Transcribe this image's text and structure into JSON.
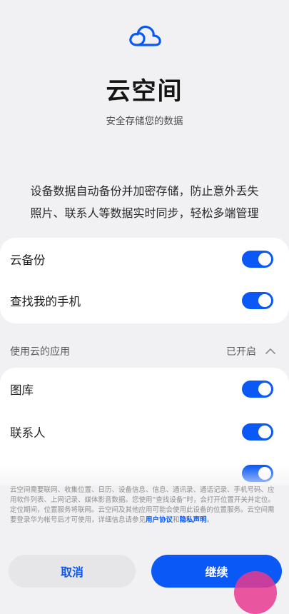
{
  "header": {
    "icon": "cloud-icon",
    "title": "云空间",
    "subtitle": "安全存储您的数据"
  },
  "description": {
    "line1": "设备数据自动备份并加密存储，防止意外丢失",
    "line2": "照片、联系人等数据实时同步，轻松多端管理"
  },
  "main_settings": [
    {
      "label": "云备份",
      "enabled": true
    },
    {
      "label": "查找我的手机",
      "enabled": true
    }
  ],
  "apps_section": {
    "title": "使用云的应用",
    "status": "已开启",
    "expand_icon": "chevron-up-icon",
    "items": [
      {
        "label": "图库",
        "enabled": true
      },
      {
        "label": "联系人",
        "enabled": true
      }
    ]
  },
  "notice": {
    "text": "云空间需要联网、收集位置、日历、设备信息、信息、通讯录、通话记录、手机号码、应用软件列表、上网记录、媒体影音数据。您使用“查找设备”时，会打开位置开关并定位。定位期间，位置服务将联网。云空间及其他应用可能会使用此设备的位置服务。云空间需要登录华为帐号后才可使用，详细信息请参见",
    "link1": "用户协议",
    "connector": "和",
    "link2": "隐私声明",
    "end": "。"
  },
  "buttons": {
    "cancel": "取消",
    "continue": "继续"
  },
  "colors": {
    "accent": "#0a59f7",
    "background": "#f1f1f3",
    "card": "#ffffff"
  }
}
